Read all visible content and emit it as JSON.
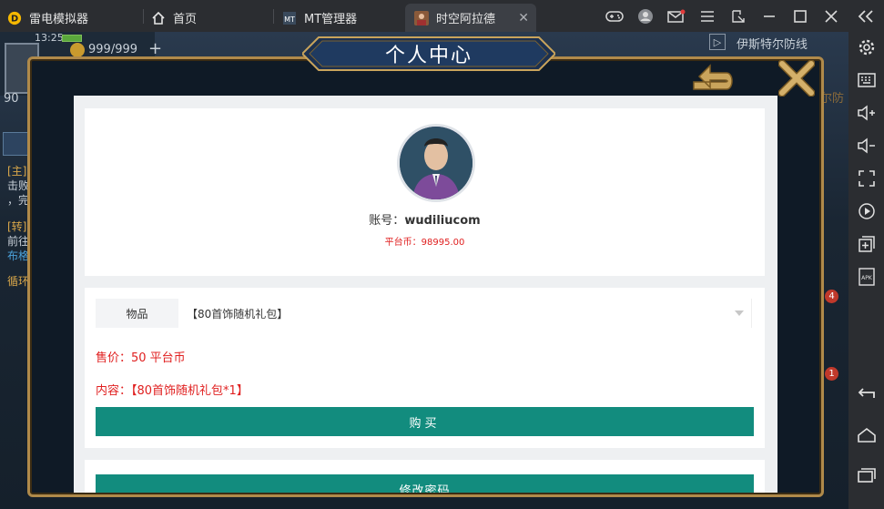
{
  "titlebar": {
    "app_name": "雷电模拟器",
    "tabs": [
      {
        "label": "首页",
        "icon": "home-icon"
      },
      {
        "label": "MT管理器",
        "icon": "mt-manager-icon"
      },
      {
        "label": "时空阿拉德",
        "icon": "game-icon"
      }
    ],
    "buttons": [
      "gamepad-icon",
      "avatar-icon",
      "mail-icon",
      "menu-icon",
      "shrink-icon",
      "minimize-icon",
      "maximize-icon",
      "close-icon",
      "collapse-sidebar-icon"
    ]
  },
  "hud": {
    "time": "13:25",
    "resource": "999/999",
    "level": "90",
    "region": "伊斯特尔防线",
    "quest_tags": [
      "[主]",
      "[转]",
      "循环"
    ],
    "quest_lines": [
      "击败",
      "，完",
      "前往",
      "布格"
    ],
    "right_label": "尔防",
    "badges": [
      "4",
      "1"
    ]
  },
  "dialog": {
    "title": "个人中心"
  },
  "profile": {
    "account_label": "账号：",
    "account": "wudiliucom",
    "coins": "平台币：98995.00"
  },
  "purchase": {
    "item_label": "物品",
    "item_value": "【80首饰随机礼包】",
    "price": "售价：50 平台币",
    "content": "内容：【80首饰随机礼包*1】",
    "buy_label": "购买"
  },
  "account_actions": {
    "change_password_label": "修改密码"
  },
  "sidebar": [
    "settings-icon",
    "keyboard-icon",
    "volume-up-icon",
    "volume-down-icon",
    "fullscreen-icon",
    "record-icon",
    "add-window-icon",
    "apk-icon",
    "back-icon",
    "home-icon",
    "recents-icon"
  ],
  "colors": {
    "accent_teal": "#128c7e",
    "price_red": "#e02020",
    "gold_border": "#b08a4a"
  }
}
